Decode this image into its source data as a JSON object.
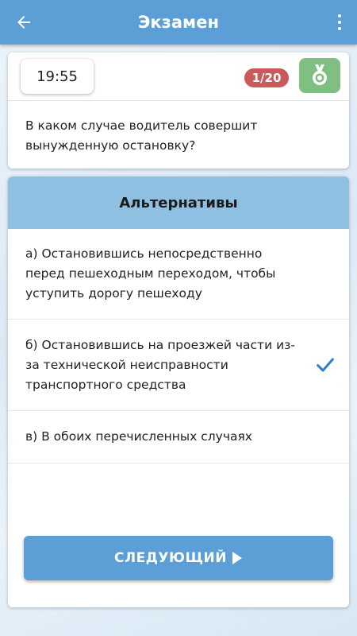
{
  "appbar": {
    "title": "Экзамен",
    "back_icon": "arrow-left-icon",
    "menu_icon": "more-vertical-icon"
  },
  "question_card": {
    "timer": "19:55",
    "counter": "1/20",
    "medal_icon": "medal-icon",
    "question": "В каком случае водитель совершит вынужденную остановку?"
  },
  "answers": {
    "header": "Альтернативы",
    "options": [
      {
        "text": "а) Остановившись непосредственно перед пешеходным переходом, чтобы уступить дорогу пешеходу",
        "selected": false
      },
      {
        "text": "б) Остановившись на проезжей части из-за технической неисправности транспортного средства",
        "selected": true
      },
      {
        "text": "в) В обоих перечисленных случаях",
        "selected": false
      }
    ]
  },
  "next_button": {
    "label": "СЛЕДУЮЩИЙ",
    "icon": "play-icon"
  },
  "colors": {
    "primary": "#5b9fd6",
    "header": "#8fc0e1",
    "counter": "#c9595a",
    "medal": "#7fbf82",
    "check": "#2d7fd6"
  }
}
